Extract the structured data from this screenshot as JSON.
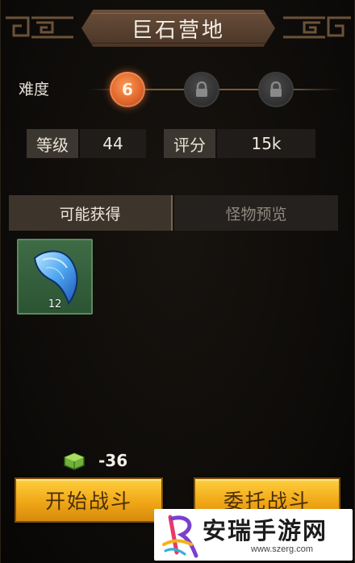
{
  "header": {
    "title": "巨石营地"
  },
  "difficulty": {
    "label": "难度",
    "current": "6",
    "nodes": [
      {
        "state": "active",
        "value": "6"
      },
      {
        "state": "locked",
        "icon": "lock-icon"
      },
      {
        "state": "locked",
        "icon": "lock-icon"
      }
    ]
  },
  "stats": {
    "level_label": "等级",
    "level_value": "44",
    "score_label": "评分",
    "score_value": "15k"
  },
  "tabs": [
    {
      "label": "可能获得",
      "active": true
    },
    {
      "label": "怪物预览",
      "active": false
    }
  ],
  "rewards": [
    {
      "icon": "blue-claw-icon",
      "count": "12"
    }
  ],
  "cost": {
    "icon": "green-cube-icon",
    "value": "-36"
  },
  "buttons": {
    "start": "开始战斗",
    "entrust": "委托战斗"
  },
  "watermark": {
    "text": "安瑞手游网",
    "url": "www.szerg.com"
  },
  "colors": {
    "accent_orange": "#e0662c",
    "button_gold": "#f0a716",
    "item_green": "#3e6c45"
  }
}
